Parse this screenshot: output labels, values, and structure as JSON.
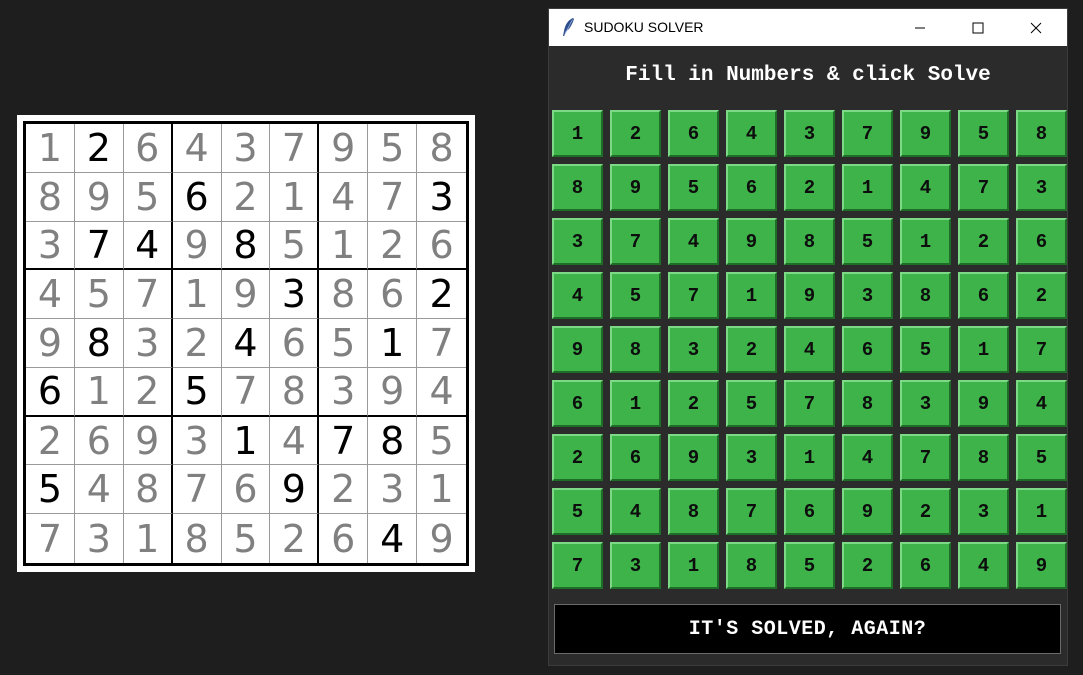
{
  "puzzle_image": {
    "grid": [
      [
        "1",
        "2",
        "6",
        "4",
        "3",
        "7",
        "9",
        "5",
        "8"
      ],
      [
        "8",
        "9",
        "5",
        "6",
        "2",
        "1",
        "4",
        "7",
        "3"
      ],
      [
        "3",
        "7",
        "4",
        "9",
        "8",
        "5",
        "1",
        "2",
        "6"
      ],
      [
        "4",
        "5",
        "7",
        "1",
        "9",
        "3",
        "8",
        "6",
        "2"
      ],
      [
        "9",
        "8",
        "3",
        "2",
        "4",
        "6",
        "5",
        "1",
        "7"
      ],
      [
        "6",
        "1",
        "2",
        "5",
        "7",
        "8",
        "3",
        "9",
        "4"
      ],
      [
        "2",
        "6",
        "9",
        "3",
        "1",
        "4",
        "7",
        "8",
        "5"
      ],
      [
        "5",
        "4",
        "8",
        "7",
        "6",
        "9",
        "2",
        "3",
        "1"
      ],
      [
        "7",
        "3",
        "1",
        "8",
        "5",
        "2",
        "6",
        "4",
        "9"
      ]
    ],
    "given": [
      [
        0,
        1,
        0,
        0,
        0,
        0,
        0,
        0,
        0
      ],
      [
        0,
        0,
        0,
        1,
        0,
        0,
        0,
        0,
        1
      ],
      [
        0,
        1,
        1,
        0,
        1,
        0,
        0,
        0,
        0
      ],
      [
        0,
        0,
        0,
        0,
        0,
        1,
        0,
        0,
        1
      ],
      [
        0,
        1,
        0,
        0,
        1,
        0,
        0,
        1,
        0
      ],
      [
        1,
        0,
        0,
        1,
        0,
        0,
        0,
        0,
        0
      ],
      [
        0,
        0,
        0,
        0,
        1,
        0,
        1,
        1,
        0
      ],
      [
        1,
        0,
        0,
        0,
        0,
        1,
        0,
        0,
        0
      ],
      [
        0,
        0,
        0,
        0,
        0,
        0,
        0,
        1,
        0
      ]
    ]
  },
  "window": {
    "title": "SUDOKU SOLVER",
    "icon": "feather-icon",
    "controls": [
      "minimize-icon",
      "maximize-icon",
      "close-icon"
    ]
  },
  "heading": "Fill in Numbers & click Solve",
  "board": {
    "cell_color": "#3db34a",
    "grid": [
      [
        "1",
        "2",
        "6",
        "4",
        "3",
        "7",
        "9",
        "5",
        "8"
      ],
      [
        "8",
        "9",
        "5",
        "6",
        "2",
        "1",
        "4",
        "7",
        "3"
      ],
      [
        "3",
        "7",
        "4",
        "9",
        "8",
        "5",
        "1",
        "2",
        "6"
      ],
      [
        "4",
        "5",
        "7",
        "1",
        "9",
        "3",
        "8",
        "6",
        "2"
      ],
      [
        "9",
        "8",
        "3",
        "2",
        "4",
        "6",
        "5",
        "1",
        "7"
      ],
      [
        "6",
        "1",
        "2",
        "5",
        "7",
        "8",
        "3",
        "9",
        "4"
      ],
      [
        "2",
        "6",
        "9",
        "3",
        "1",
        "4",
        "7",
        "8",
        "5"
      ],
      [
        "5",
        "4",
        "8",
        "7",
        "6",
        "9",
        "2",
        "3",
        "1"
      ],
      [
        "7",
        "3",
        "1",
        "8",
        "5",
        "2",
        "6",
        "4",
        "9"
      ]
    ]
  },
  "solve_button": {
    "label": "IT'S SOLVED, AGAIN?"
  }
}
